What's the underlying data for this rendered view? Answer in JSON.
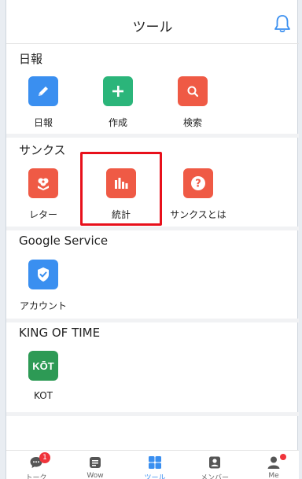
{
  "header": {
    "title": "ツール"
  },
  "sections": {
    "nippo": {
      "title": "日報",
      "items": [
        {
          "label": "日報",
          "icon": "edit-document-icon",
          "color": "#3a8ff0"
        },
        {
          "label": "作成",
          "icon": "add-document-icon",
          "color": "#2bb57a"
        },
        {
          "label": "検索",
          "icon": "search-document-icon",
          "color": "#ef5a45"
        }
      ]
    },
    "thanks": {
      "title": "サンクス",
      "items": [
        {
          "label": "レター",
          "icon": "flower-letter-icon",
          "color": "#ef5a45"
        },
        {
          "label": "統計",
          "icon": "bar-chart-icon",
          "color": "#ef5a45"
        },
        {
          "label": "サンクスとは",
          "icon": "help-icon",
          "color": "#ef5a45"
        }
      ]
    },
    "google": {
      "title": "Google Service",
      "items": [
        {
          "label": "アカウント",
          "icon": "shield-check-icon",
          "color": "#3a8ff0"
        }
      ]
    },
    "kot": {
      "title": "KING OF TIME",
      "items": [
        {
          "label": "KOT",
          "icon": "kot-logo-icon",
          "color": "#2d9a55",
          "logo_text": "KŌT"
        }
      ]
    }
  },
  "tabbar": {
    "tabs": [
      {
        "label": "トーク",
        "icon": "chat-icon",
        "badge": "1"
      },
      {
        "label": "Wow",
        "icon": "wow-icon"
      },
      {
        "label": "ツール",
        "icon": "grid-icon",
        "active": true
      },
      {
        "label": "メンバー",
        "icon": "contacts-icon"
      },
      {
        "label": "Me",
        "icon": "person-icon"
      }
    ],
    "active_color": "#3a8ff0",
    "inactive_color": "#555555"
  },
  "highlight_color": "#e8101b"
}
